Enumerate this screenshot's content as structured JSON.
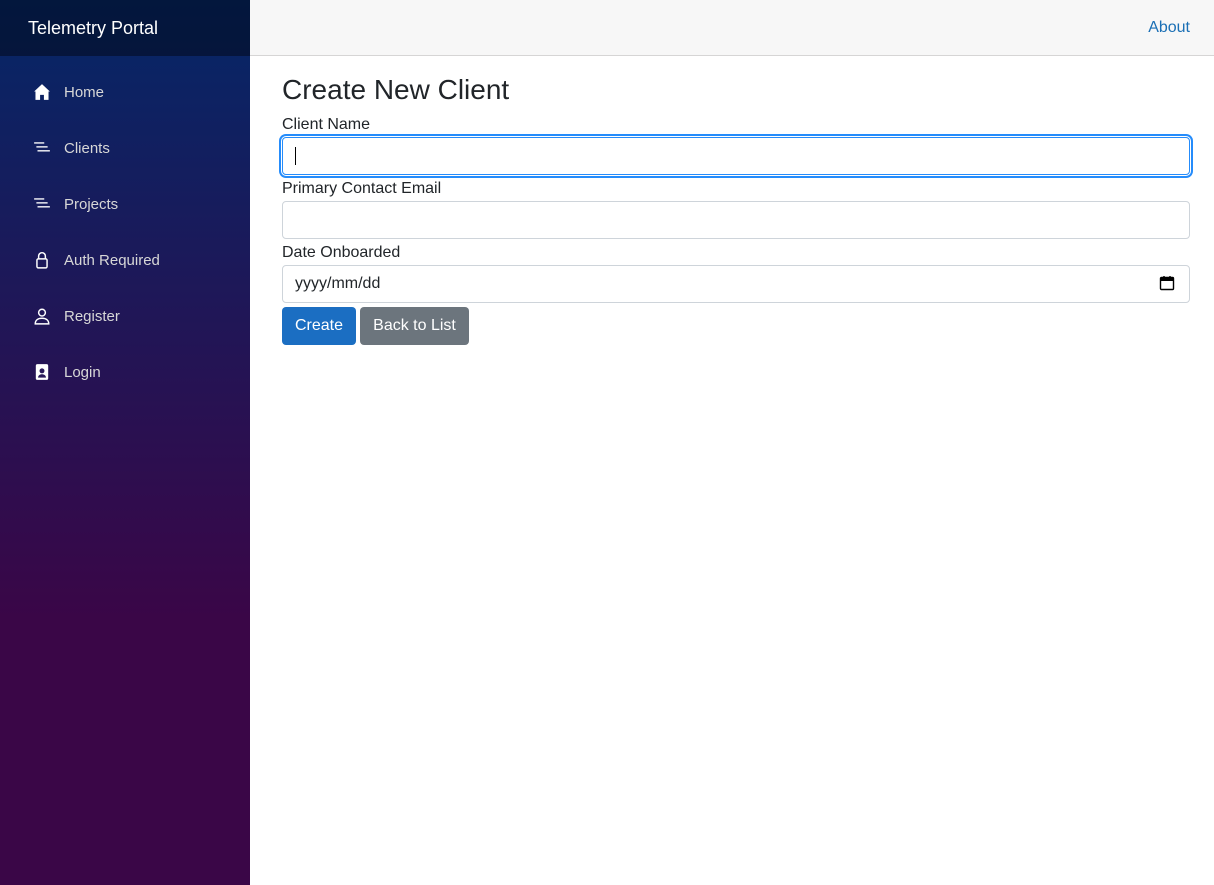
{
  "brand": "Telemetry Portal",
  "top_nav": {
    "about": "About"
  },
  "sidebar": {
    "items": [
      {
        "label": "Home",
        "icon": "home-icon"
      },
      {
        "label": "Clients",
        "icon": "list-icon"
      },
      {
        "label": "Projects",
        "icon": "list-icon"
      },
      {
        "label": "Auth Required",
        "icon": "lock-icon"
      },
      {
        "label": "Register",
        "icon": "person-icon"
      },
      {
        "label": "Login",
        "icon": "person-badge-icon"
      }
    ]
  },
  "page": {
    "title": "Create New Client"
  },
  "form": {
    "client_name_label": "Client Name",
    "client_name_value": "",
    "email_label": "Primary Contact Email",
    "email_value": "",
    "date_label": "Date Onboarded",
    "date_placeholder": "yyyy/mm/dd"
  },
  "buttons": {
    "create": "Create",
    "back": "Back to List"
  },
  "colors": {
    "sidebar_top": "#052767",
    "sidebar_bottom": "#3a0647",
    "primary": "#1b6ec2",
    "secondary": "#6c757d",
    "link": "#1a6fb5",
    "focus": "#258cfb"
  }
}
